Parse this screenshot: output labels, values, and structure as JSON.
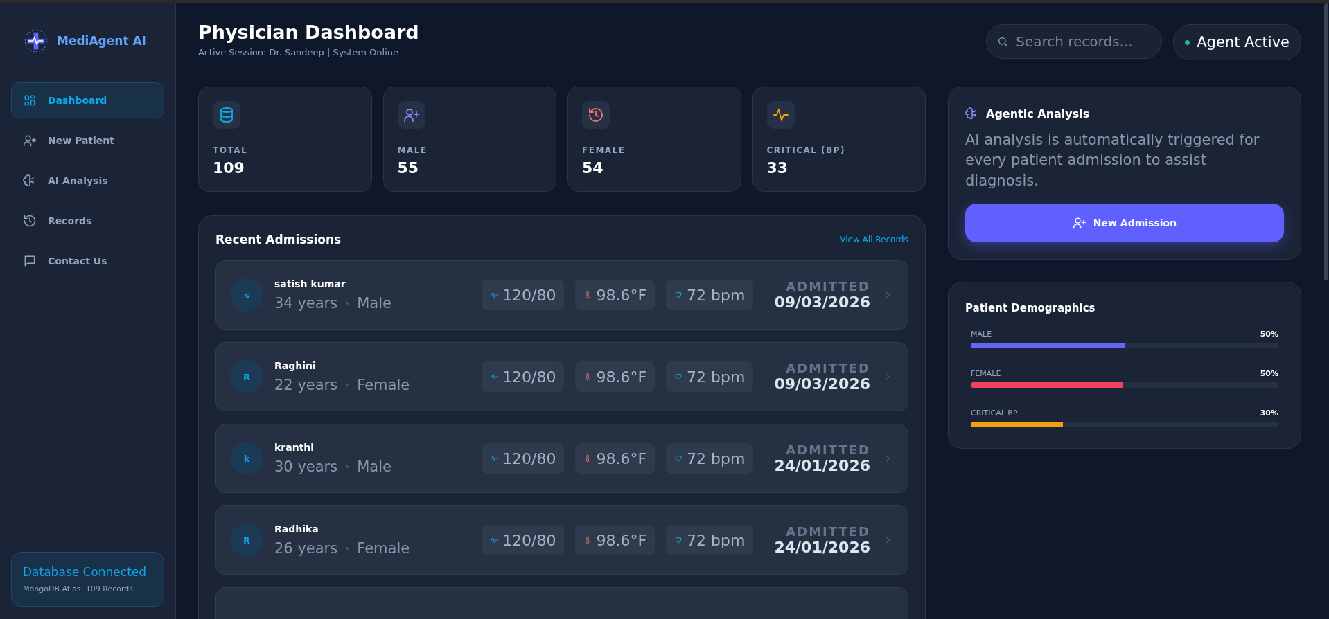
{
  "brand": {
    "name": "MediAgent AI"
  },
  "sidebar": {
    "items": [
      {
        "label": "Dashboard",
        "kind": "grid",
        "selected": true
      },
      {
        "label": "New Patient",
        "kind": "person",
        "selected": false
      },
      {
        "label": "AI Analysis",
        "kind": "analysis",
        "selected": false
      },
      {
        "label": "Records",
        "kind": "records",
        "selected": false
      },
      {
        "label": "Contact Us",
        "kind": "contact",
        "selected": false
      }
    ],
    "status": {
      "title": "Database Connected",
      "detail": "MongoDB Atlas: 109 Records"
    }
  },
  "header": {
    "title": "Physician Dashboard",
    "subtitle": "Active Session: Dr. Sandeep | System Online",
    "search": {
      "placeholder": "Search records..."
    },
    "agent": {
      "label": "Agent Active",
      "online": true
    }
  },
  "stats": [
    {
      "label": "TOTAL",
      "value": "109",
      "kind": "total"
    },
    {
      "label": "MALE",
      "value": "55",
      "kind": "male"
    },
    {
      "label": "FEMALE",
      "value": "54",
      "kind": "female"
    },
    {
      "label": "CRITICAL (BP)",
      "value": "33",
      "kind": "critical"
    }
  ],
  "admissions": {
    "title": "Recent Admissions",
    "link": "View All Records",
    "rows": [
      {
        "initial": "s",
        "name": "satish kumar",
        "age": "34 years",
        "gender": "Male",
        "bp": "120/80",
        "temp": "98.6°F",
        "pulse": "72 bpm",
        "status": "ADMITTED",
        "date": "09/03/2026"
      },
      {
        "initial": "R",
        "name": "Raghini",
        "age": "22 years",
        "gender": "Female",
        "bp": "120/80",
        "temp": "98.6°F",
        "pulse": "72 bpm",
        "status": "ADMITTED",
        "date": "09/03/2026"
      },
      {
        "initial": "k",
        "name": "kranthi",
        "age": "30 years",
        "gender": "Male",
        "bp": "120/80",
        "temp": "98.6°F",
        "pulse": "72 bpm",
        "status": "ADMITTED",
        "date": "24/01/2026"
      },
      {
        "initial": "R",
        "name": "Radhika",
        "age": "26 years",
        "gender": "Female",
        "bp": "120/80",
        "temp": "98.6°F",
        "pulse": "72 bpm",
        "status": "ADMITTED",
        "date": "24/01/2026"
      }
    ]
  },
  "analysis": {
    "title": "Agentic Analysis",
    "text": "AI analysis is automatically triggered for every patient admission to assist diagnosis.",
    "button": "New Admission"
  },
  "demographics": {
    "title": "Patient Demographics",
    "bars": [
      {
        "label": "MALE",
        "value": "50%",
        "level": 0.5,
        "color": "#6366f1"
      },
      {
        "label": "FEMALE",
        "value": "50%",
        "level": 0.495,
        "color": "#f43f5e"
      },
      {
        "label": "CRITICAL BP",
        "value": "30%",
        "level": 0.3,
        "color": "#f59e0b"
      }
    ]
  }
}
